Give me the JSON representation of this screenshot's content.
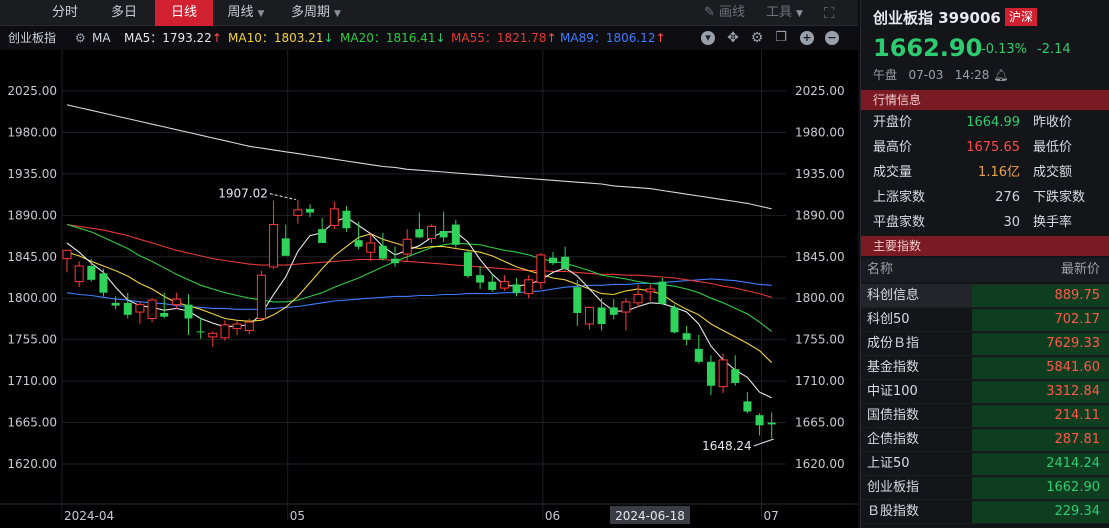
{
  "toolbar": {
    "tabs": [
      "分时",
      "多日",
      "日线",
      "周线",
      "多周期"
    ],
    "active_tab": "日线",
    "draw_label": "画线",
    "tools_label": "工具"
  },
  "legend": {
    "index_name": "创业板指",
    "ma_label": "MA",
    "ma5": "MA5：1793.22",
    "ma10": "MA10：1803.21",
    "ma20": "MA20：1816.41",
    "ma55": "MA55：1821.78",
    "ma89": "MA89：1806.12",
    "arrow_up": "↑",
    "arrow_down": "↓",
    "colors": {
      "ma5": "#e8e8e8",
      "ma10": "#f2d13a",
      "ma20": "#2ecc40",
      "ma55": "#e53935",
      "ma89": "#3d7bff"
    }
  },
  "chart_data": {
    "type": "candlestick",
    "y_ticks": [
      "2025.00",
      "1980.00",
      "1935.00",
      "1890.00",
      "1845.00",
      "1800.00",
      "1755.00",
      "1710.00",
      "1665.00",
      "1620.00"
    ],
    "ylim": [
      1605,
      2045
    ],
    "x_labels": [
      "2024-04",
      "05",
      "06",
      "07"
    ],
    "cursor_date": "2024-06-18",
    "high_annotation": "1907.02",
    "low_annotation": "1648.24",
    "candles": [
      {
        "o": 1843,
        "h": 1850,
        "l": 1828,
        "c": 1852
      },
      {
        "o": 1818,
        "h": 1840,
        "l": 1812,
        "c": 1835
      },
      {
        "o": 1835,
        "h": 1843,
        "l": 1818,
        "c": 1820
      },
      {
        "o": 1827,
        "h": 1832,
        "l": 1802,
        "c": 1806
      },
      {
        "o": 1795,
        "h": 1802,
        "l": 1788,
        "c": 1792
      },
      {
        "o": 1795,
        "h": 1806,
        "l": 1778,
        "c": 1782
      },
      {
        "o": 1785,
        "h": 1797,
        "l": 1772,
        "c": 1793
      },
      {
        "o": 1778,
        "h": 1800,
        "l": 1774,
        "c": 1798
      },
      {
        "o": 1784,
        "h": 1806,
        "l": 1778,
        "c": 1780
      },
      {
        "o": 1793,
        "h": 1806,
        "l": 1788,
        "c": 1799
      },
      {
        "o": 1793,
        "h": 1804,
        "l": 1760,
        "c": 1778
      },
      {
        "o": 1764,
        "h": 1779,
        "l": 1756,
        "c": 1763
      },
      {
        "o": 1758,
        "h": 1764,
        "l": 1747,
        "c": 1762
      },
      {
        "o": 1757,
        "h": 1776,
        "l": 1754,
        "c": 1771
      },
      {
        "o": 1767,
        "h": 1775,
        "l": 1760,
        "c": 1772
      },
      {
        "o": 1765,
        "h": 1778,
        "l": 1761,
        "c": 1774
      },
      {
        "o": 1778,
        "h": 1830,
        "l": 1775,
        "c": 1825
      },
      {
        "o": 1834,
        "h": 1906,
        "l": 1832,
        "c": 1880
      },
      {
        "o": 1865,
        "h": 1880,
        "l": 1849,
        "c": 1846
      },
      {
        "o": 1890,
        "h": 1907,
        "l": 1881,
        "c": 1896
      },
      {
        "o": 1897,
        "h": 1902,
        "l": 1888,
        "c": 1893
      },
      {
        "o": 1875,
        "h": 1887,
        "l": 1860,
        "c": 1860
      },
      {
        "o": 1879,
        "h": 1905,
        "l": 1875,
        "c": 1897
      },
      {
        "o": 1895,
        "h": 1900,
        "l": 1872,
        "c": 1876
      },
      {
        "o": 1863,
        "h": 1883,
        "l": 1853,
        "c": 1856
      },
      {
        "o": 1850,
        "h": 1870,
        "l": 1840,
        "c": 1860
      },
      {
        "o": 1857,
        "h": 1871,
        "l": 1841,
        "c": 1843
      },
      {
        "o": 1843,
        "h": 1856,
        "l": 1834,
        "c": 1838
      },
      {
        "o": 1848,
        "h": 1875,
        "l": 1840,
        "c": 1864
      },
      {
        "o": 1875,
        "h": 1893,
        "l": 1865,
        "c": 1866
      },
      {
        "o": 1865,
        "h": 1880,
        "l": 1860,
        "c": 1878
      },
      {
        "o": 1873,
        "h": 1894,
        "l": 1861,
        "c": 1866
      },
      {
        "o": 1880,
        "h": 1885,
        "l": 1855,
        "c": 1858
      },
      {
        "o": 1850,
        "h": 1853,
        "l": 1822,
        "c": 1824
      },
      {
        "o": 1825,
        "h": 1835,
        "l": 1810,
        "c": 1817
      },
      {
        "o": 1818,
        "h": 1826,
        "l": 1807,
        "c": 1809
      },
      {
        "o": 1811,
        "h": 1825,
        "l": 1808,
        "c": 1818
      },
      {
        "o": 1815,
        "h": 1822,
        "l": 1802,
        "c": 1806
      },
      {
        "o": 1805,
        "h": 1825,
        "l": 1800,
        "c": 1820
      },
      {
        "o": 1817,
        "h": 1849,
        "l": 1810,
        "c": 1847
      },
      {
        "o": 1844,
        "h": 1850,
        "l": 1836,
        "c": 1838
      },
      {
        "o": 1845,
        "h": 1856,
        "l": 1830,
        "c": 1832
      },
      {
        "o": 1812,
        "h": 1820,
        "l": 1770,
        "c": 1784
      },
      {
        "o": 1772,
        "h": 1791,
        "l": 1766,
        "c": 1790
      },
      {
        "o": 1790,
        "h": 1800,
        "l": 1765,
        "c": 1772
      },
      {
        "o": 1790,
        "h": 1799,
        "l": 1777,
        "c": 1782
      },
      {
        "o": 1785,
        "h": 1800,
        "l": 1765,
        "c": 1796
      },
      {
        "o": 1795,
        "h": 1815,
        "l": 1790,
        "c": 1804
      },
      {
        "o": 1807,
        "h": 1815,
        "l": 1797,
        "c": 1810
      },
      {
        "o": 1818,
        "h": 1822,
        "l": 1793,
        "c": 1794
      },
      {
        "o": 1790,
        "h": 1793,
        "l": 1762,
        "c": 1763
      },
      {
        "o": 1762,
        "h": 1770,
        "l": 1749,
        "c": 1755
      },
      {
        "o": 1745,
        "h": 1760,
        "l": 1729,
        "c": 1731
      },
      {
        "o": 1731,
        "h": 1738,
        "l": 1695,
        "c": 1705
      },
      {
        "o": 1704,
        "h": 1740,
        "l": 1697,
        "c": 1733
      },
      {
        "o": 1723,
        "h": 1738,
        "l": 1705,
        "c": 1708
      },
      {
        "o": 1688,
        "h": 1698,
        "l": 1675,
        "c": 1677
      },
      {
        "o": 1673,
        "h": 1675,
        "l": 1651,
        "c": 1662
      },
      {
        "o": 1665,
        "h": 1676,
        "l": 1648,
        "c": 1663
      }
    ],
    "ma5": [
      1860,
      1850,
      1838,
      1828,
      1812,
      1798,
      1792,
      1790,
      1787,
      1789,
      1786,
      1778,
      1773,
      1769,
      1770,
      1771,
      1783,
      1804,
      1823,
      1851,
      1868,
      1871,
      1883,
      1888,
      1879,
      1870,
      1856,
      1847,
      1852,
      1857,
      1866,
      1872,
      1872,
      1861,
      1842,
      1826,
      1814,
      1813,
      1815,
      1820,
      1828,
      1833,
      1824,
      1810,
      1796,
      1786,
      1786,
      1791,
      1795,
      1794,
      1790,
      1785,
      1772,
      1748,
      1733,
      1722,
      1714,
      1698,
      1692
    ],
    "ma10": [
      1850,
      1846,
      1840,
      1835,
      1830,
      1824,
      1816,
      1810,
      1802,
      1795,
      1792,
      1788,
      1783,
      1778,
      1776,
      1775,
      1776,
      1782,
      1790,
      1802,
      1817,
      1832,
      1846,
      1856,
      1866,
      1870,
      1864,
      1860,
      1856,
      1854,
      1856,
      1856,
      1854,
      1852,
      1850,
      1846,
      1840,
      1834,
      1830,
      1826,
      1822,
      1820,
      1815,
      1810,
      1805,
      1804,
      1808,
      1810,
      1808,
      1804,
      1795,
      1788,
      1782,
      1772,
      1765,
      1758,
      1751,
      1743,
      1730
    ],
    "ma20": [
      1880,
      1876,
      1872,
      1866,
      1860,
      1854,
      1846,
      1840,
      1833,
      1826,
      1820,
      1814,
      1810,
      1806,
      1803,
      1800,
      1798,
      1796,
      1796,
      1798,
      1802,
      1806,
      1812,
      1817,
      1822,
      1828,
      1834,
      1840,
      1845,
      1850,
      1855,
      1858,
      1860,
      1859,
      1858,
      1855,
      1852,
      1850,
      1847,
      1843,
      1840,
      1838,
      1834,
      1830,
      1825,
      1823,
      1821,
      1818,
      1816,
      1815,
      1813,
      1810,
      1806,
      1800,
      1795,
      1789,
      1783,
      1774,
      1764
    ],
    "ma55": [
      1880,
      1878,
      1876,
      1874,
      1871,
      1868,
      1864,
      1860,
      1856,
      1852,
      1849,
      1846,
      1843,
      1841,
      1839,
      1837,
      1836,
      1836,
      1836,
      1837,
      1838,
      1839,
      1840,
      1841,
      1842,
      1842,
      1842,
      1841,
      1840,
      1839,
      1838,
      1837,
      1836,
      1835,
      1834,
      1833,
      1832,
      1831,
      1830,
      1830,
      1829,
      1829,
      1828,
      1827,
      1826,
      1826,
      1825,
      1825,
      1824,
      1823,
      1822,
      1820,
      1818,
      1816,
      1813,
      1811,
      1808,
      1805,
      1801
    ],
    "ma89": [
      1806,
      1804,
      1803,
      1801,
      1799,
      1798,
      1796,
      1795,
      1794,
      1792,
      1791,
      1790,
      1789,
      1789,
      1788,
      1788,
      1788,
      1789,
      1790,
      1791,
      1793,
      1795,
      1797,
      1798,
      1799,
      1800,
      1801,
      1802,
      1802,
      1803,
      1803,
      1804,
      1804,
      1805,
      1805,
      1805,
      1806,
      1806,
      1807,
      1808,
      1810,
      1812,
      1813,
      1814,
      1814,
      1815,
      1815,
      1816,
      1816,
      1817,
      1818,
      1819,
      1820,
      1821,
      1820,
      1819,
      1817,
      1815,
      1814
    ],
    "ma200": [
      2010,
      2007,
      2004,
      2001,
      1998,
      1995,
      1992,
      1989,
      1986,
      1983,
      1980,
      1977,
      1974,
      1971,
      1968,
      1965,
      1963,
      1961,
      1959,
      1957,
      1955,
      1953,
      1951,
      1949,
      1947,
      1945,
      1943,
      1942,
      1940,
      1939,
      1938,
      1937,
      1936,
      1935,
      1934,
      1933,
      1932,
      1931,
      1930,
      1929,
      1928,
      1927,
      1926,
      1925,
      1924,
      1922,
      1921,
      1920,
      1919,
      1917,
      1915,
      1913,
      1911,
      1909,
      1907,
      1905,
      1903,
      1900,
      1897
    ]
  },
  "panel": {
    "name": "创业板指",
    "code": "399006",
    "market_badge": "沪深",
    "price": "1662.90",
    "change_pct": "-0.13%",
    "change": "-2.14",
    "session": "午盘",
    "date": "07-03",
    "time": "14:28",
    "quote_header": "行情信息",
    "quote_rows": [
      {
        "l1": "开盘价",
        "v1": "1664.99",
        "c1": "#2ecc71",
        "l2": "昨收价",
        "v2": ""
      },
      {
        "l1": "最高价",
        "v1": "1675.65",
        "c1": "#ff4a4a",
        "l2": "最低价",
        "v2": ""
      },
      {
        "l1": "成交量",
        "v1": "1.16亿",
        "c1": "#e8a34a",
        "l2": "成交额",
        "v2": ""
      },
      {
        "l1": "上涨家数",
        "v1": "276",
        "c1": "#cfd3dc",
        "l2": "下跌家数",
        "v2": ""
      },
      {
        "l1": "平盘家数",
        "v1": "30",
        "c1": "#cfd3dc",
        "l2": "换手率",
        "v2": ""
      }
    ],
    "index_header": "主要指数",
    "col_name": "名称",
    "col_price": "最新价",
    "indices": [
      {
        "name": "科创信息",
        "price": "889.75",
        "dir": "up"
      },
      {
        "name": "科创50",
        "price": "702.17",
        "dir": "up"
      },
      {
        "name": "成份Ｂ指",
        "price": "7629.33",
        "dir": "up"
      },
      {
        "name": "基金指数",
        "price": "5841.60",
        "dir": "up"
      },
      {
        "name": "中证100",
        "price": "3312.84",
        "dir": "up"
      },
      {
        "name": "国债指数",
        "price": "214.11",
        "dir": "up"
      },
      {
        "name": "企债指数",
        "price": "287.81",
        "dir": "up"
      },
      {
        "name": "上证50",
        "price": "2414.24",
        "dir": "dn"
      },
      {
        "name": "创业板指",
        "price": "1662.90",
        "dir": "dn"
      },
      {
        "name": "Ｂ股指数",
        "price": "229.34",
        "dir": "dn"
      }
    ]
  }
}
